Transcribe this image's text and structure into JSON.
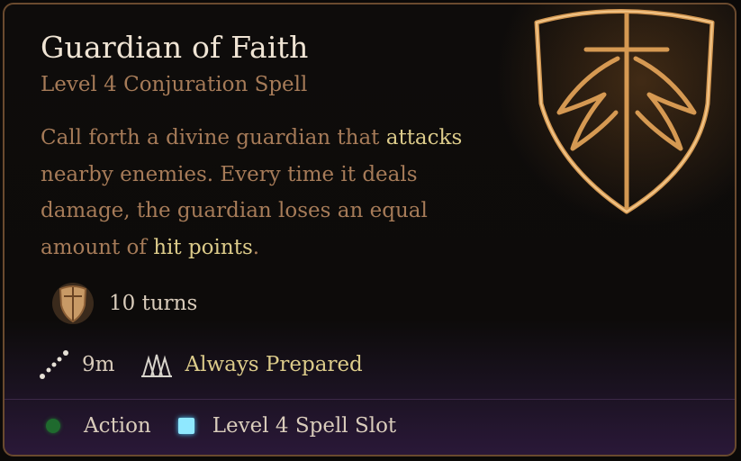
{
  "spell": {
    "name": "Guardian of Faith",
    "level_school": "Level 4 Conjuration Spell",
    "description": {
      "part1": "Call forth a divine guardian that ",
      "highlight1": "attacks",
      "part2": " nearby enemies. Every time it deals damage, the guardian loses an equal amount of ",
      "highlight2": "hit points",
      "part3": "."
    }
  },
  "stats": {
    "duration": "10 turns",
    "range": "9m",
    "preparation": "Always Prepared"
  },
  "costs": {
    "action": "Action",
    "slot": "Level 4 Spell Slot"
  },
  "icons": {
    "spell_art": "shield-sword-wings-icon",
    "duration": "shield-turns-icon",
    "range": "range-dots-icon",
    "preparation": "always-prepared-icon",
    "action": "action-dot-icon",
    "slot": "spell-slot-icon"
  },
  "colors": {
    "title": "#efe4d4",
    "body_text": "#a67b58",
    "highlight": "#dccb8a",
    "action": "#1f6a2e",
    "slot": "#8fe8ff"
  }
}
